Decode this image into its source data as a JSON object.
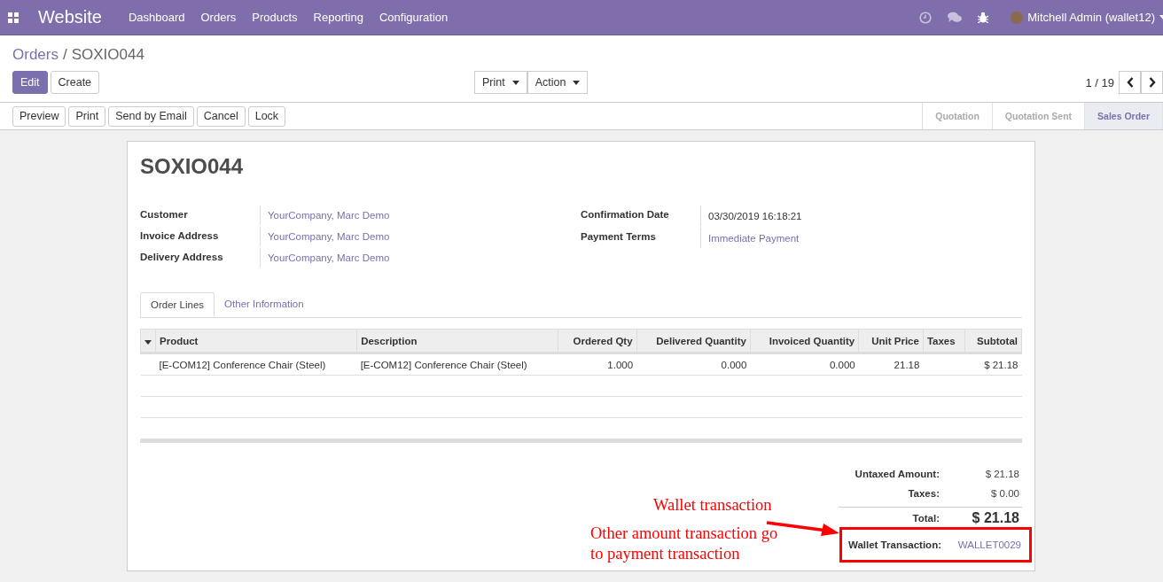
{
  "navbar": {
    "app_name": "Website",
    "menu": [
      {
        "label": "Dashboard"
      },
      {
        "label": "Orders"
      },
      {
        "label": "Products"
      },
      {
        "label": "Reporting"
      },
      {
        "label": "Configuration"
      }
    ],
    "user": "Mitchell Admin (wallet12)"
  },
  "breadcrumb": {
    "parent": "Orders",
    "separator": "/",
    "current": "SOXIO044"
  },
  "buttons": [
    {
      "label": "Edit",
      "kind": "primary"
    },
    {
      "label": "Create",
      "kind": "default"
    }
  ],
  "dropdowns": [
    {
      "label": "Print"
    },
    {
      "label": "Action"
    }
  ],
  "pager": "1 / 19",
  "action_buttons": [
    {
      "label": "Preview"
    },
    {
      "label": "Print"
    },
    {
      "label": "Send by Email"
    },
    {
      "label": "Cancel"
    },
    {
      "label": "Lock"
    }
  ],
  "stages": [
    {
      "label": "Quotation",
      "selected": false
    },
    {
      "label": "Quotation Sent",
      "selected": false
    },
    {
      "label": "Sales Order",
      "selected": true
    }
  ],
  "sheet": {
    "title": "SOXIO044",
    "left_fields": [
      {
        "label": "Customer",
        "value": "YourCompany, Marc Demo",
        "link": true
      },
      {
        "label": "Invoice Address",
        "value": "YourCompany, Marc Demo",
        "link": true
      },
      {
        "label": "Delivery Address",
        "value": "YourCompany, Marc Demo",
        "link": true
      }
    ],
    "right_fields": [
      {
        "label": "Confirmation Date",
        "value": "03/30/2019 16:18:21",
        "link": false
      },
      {
        "label": "Payment Terms",
        "value": "Immediate Payment",
        "link": true
      }
    ],
    "tabs": [
      {
        "label": "Order Lines",
        "selected": true
      },
      {
        "label": "Other Information",
        "selected": false
      }
    ],
    "table": {
      "columns": [
        {
          "label": "Product",
          "kind": "text"
        },
        {
          "label": "Description",
          "kind": "text"
        },
        {
          "label": "Ordered Qty",
          "kind": "number"
        },
        {
          "label": "Delivered Quantity",
          "kind": "number"
        },
        {
          "label": "Invoiced Quantity",
          "kind": "number"
        },
        {
          "label": "Unit Price",
          "kind": "number"
        },
        {
          "label": "Taxes",
          "kind": "text"
        },
        {
          "label": "Subtotal",
          "kind": "number"
        }
      ],
      "rows": [
        [
          "[E-COM12] Conference Chair (Steel)",
          "[E-COM12] Conference Chair (Steel)",
          "1.000",
          "0.000",
          "0.000",
          "21.18",
          "",
          "$ 21.18"
        ]
      ]
    },
    "totals": [
      {
        "label": "Untaxed Amount:",
        "value": "$ 21.18",
        "kind": "plain",
        "highlighted": false
      },
      {
        "label": "Taxes:",
        "value": "$ 0.00",
        "kind": "plain",
        "highlighted": false
      },
      {
        "label": "Total:",
        "value": "$ 21.18",
        "kind": "total",
        "highlighted": false
      },
      {
        "label": "Wallet Transaction:",
        "value": "WALLET0029",
        "kind": "link",
        "highlighted": true
      }
    ]
  },
  "annotations": [
    {
      "text": "Wallet transaction",
      "kind": "arrow"
    },
    {
      "text": "Other amount transaction go to payment transaction",
      "kind": "note"
    }
  ]
}
